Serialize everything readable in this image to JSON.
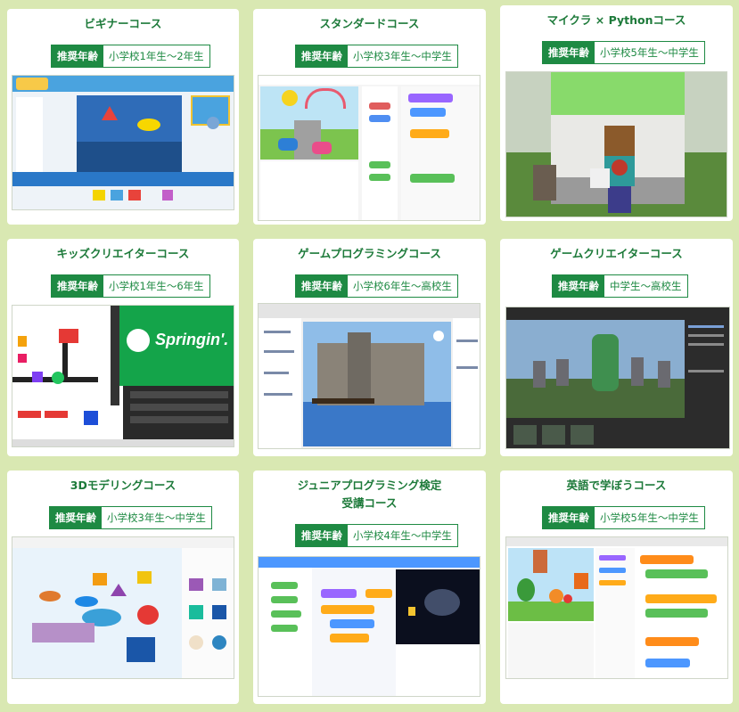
{
  "age_label": "推奨年齢",
  "courses": [
    {
      "title": "ビギナーコース",
      "age": "小学校1年生～2年生",
      "screenshot": "scratchjr-app-screenshot"
    },
    {
      "title": "スタンダードコース",
      "age": "小学校3年生～中学生",
      "screenshot": "scratch-editor-screenshot"
    },
    {
      "title": "マイクラ × Pythonコース",
      "age": "小学校5年生～中学生",
      "screenshot": "minecraft-scene-screenshot"
    },
    {
      "title": "キッズクリエイターコース",
      "age": "小学校1年生～6年生",
      "screenshot": "springin-app-screenshot",
      "logo_text": "Springin'."
    },
    {
      "title": "ゲームプログラミングコース",
      "age": "小学校6年生～高校生",
      "screenshot": "unity-editor-screenshot"
    },
    {
      "title": "ゲームクリエイターコース",
      "age": "中学生～高校生",
      "screenshot": "unreal-editor-screenshot"
    },
    {
      "title": "3Dモデリングコース",
      "age": "小学校3年生～中学生",
      "screenshot": "tinkercad-screenshot"
    },
    {
      "title_line1": "ジュニアプログラミング検定",
      "title_line2": "受講コース",
      "age": "小学校4年生～中学生",
      "screenshot": "scratch-space-project-screenshot"
    },
    {
      "title": "英語で学ぼうコース",
      "age": "小学校5年生～中学生",
      "screenshot": "scratch-english-project-screenshot"
    }
  ]
}
